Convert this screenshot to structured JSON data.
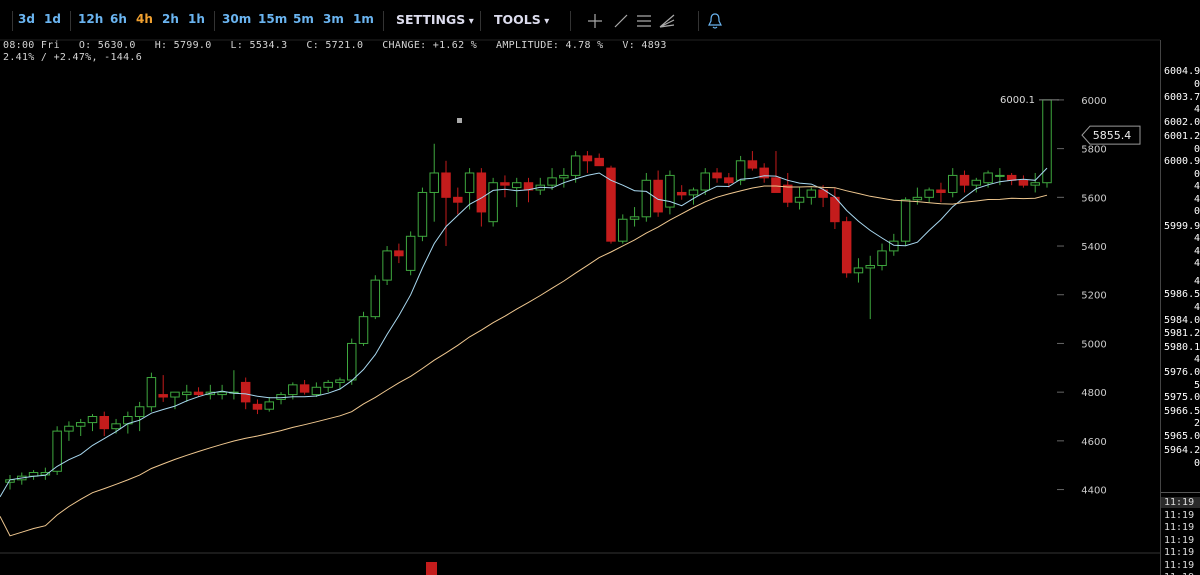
{
  "toolbar": {
    "timeframes": [
      {
        "label": "3d",
        "active": false
      },
      {
        "label": "1d",
        "active": false
      },
      {
        "label": "12h",
        "active": false
      },
      {
        "label": "6h",
        "active": false
      },
      {
        "label": "4h",
        "active": true
      },
      {
        "label": "2h",
        "active": false
      },
      {
        "label": "1h",
        "active": false
      },
      {
        "label": "30m",
        "active": false
      },
      {
        "label": "15m",
        "active": false
      },
      {
        "label": "5m",
        "active": false
      },
      {
        "label": "3m",
        "active": false
      },
      {
        "label": "1m",
        "active": false
      }
    ],
    "settings_label": "SETTINGS",
    "tools_label": "TOOLS",
    "tool_icons": [
      "crosshair-icon",
      "line-tool-icon",
      "horizontal-lines-icon",
      "fan-tool-icon",
      "alert-bell-icon"
    ]
  },
  "info": {
    "line1": "08:00 Fri   O: 5630.0   H: 5799.0   L: 5534.3   C: 5721.0   CHANGE: +1.62 %   AMPLITUDE: 4.78 %   V: 4893",
    "line2": "2.41% / +2.47%, -144.6"
  },
  "colors": {
    "up": "#3fa83f",
    "down": "#c41c1c",
    "fast_ma": "#a8d8f0",
    "slow_ma": "#f0c890",
    "grid": "#111"
  },
  "chart_data": {
    "type": "candlestick",
    "y_axis_ticks": [
      "6000",
      "5800",
      "5600",
      "5400",
      "5200",
      "5000",
      "4800",
      "4600",
      "4400"
    ],
    "ylim": [
      4275,
      6090
    ],
    "last_price_label": "5855.4",
    "high_marker_label": "6000.1",
    "candles": [
      {
        "o": 4430,
        "h": 4460,
        "l": 4400,
        "c": 4440
      },
      {
        "o": 4440,
        "h": 4470,
        "l": 4420,
        "c": 4455
      },
      {
        "o": 4455,
        "h": 4480,
        "l": 4440,
        "c": 4470
      },
      {
        "o": 4460,
        "h": 4490,
        "l": 4440,
        "c": 4470
      },
      {
        "o": 4475,
        "h": 4660,
        "l": 4460,
        "c": 4640
      },
      {
        "o": 4640,
        "h": 4680,
        "l": 4600,
        "c": 4660
      },
      {
        "o": 4660,
        "h": 4690,
        "l": 4620,
        "c": 4675
      },
      {
        "o": 4675,
        "h": 4710,
        "l": 4640,
        "c": 4700
      },
      {
        "o": 4700,
        "h": 4720,
        "l": 4620,
        "c": 4650
      },
      {
        "o": 4650,
        "h": 4690,
        "l": 4630,
        "c": 4670
      },
      {
        "o": 4670,
        "h": 4720,
        "l": 4630,
        "c": 4700
      },
      {
        "o": 4700,
        "h": 4760,
        "l": 4640,
        "c": 4740
      },
      {
        "o": 4740,
        "h": 4880,
        "l": 4720,
        "c": 4860
      },
      {
        "o": 4790,
        "h": 4870,
        "l": 4760,
        "c": 4780
      },
      {
        "o": 4780,
        "h": 4800,
        "l": 4730,
        "c": 4800
      },
      {
        "o": 4790,
        "h": 4830,
        "l": 4760,
        "c": 4800
      },
      {
        "o": 4800,
        "h": 4820,
        "l": 4780,
        "c": 4790
      },
      {
        "o": 4790,
        "h": 4830,
        "l": 4770,
        "c": 4800
      },
      {
        "o": 4790,
        "h": 4830,
        "l": 4770,
        "c": 4800
      },
      {
        "o": 4800,
        "h": 4890,
        "l": 4770,
        "c": 4800
      },
      {
        "o": 4840,
        "h": 4860,
        "l": 4730,
        "c": 4760
      },
      {
        "o": 4750,
        "h": 4770,
        "l": 4710,
        "c": 4730
      },
      {
        "o": 4730,
        "h": 4780,
        "l": 4720,
        "c": 4760
      },
      {
        "o": 4770,
        "h": 4800,
        "l": 4750,
        "c": 4790
      },
      {
        "o": 4790,
        "h": 4840,
        "l": 4770,
        "c": 4830
      },
      {
        "o": 4830,
        "h": 4850,
        "l": 4790,
        "c": 4800
      },
      {
        "o": 4790,
        "h": 4840,
        "l": 4780,
        "c": 4820
      },
      {
        "o": 4820,
        "h": 4850,
        "l": 4800,
        "c": 4840
      },
      {
        "o": 4840,
        "h": 4860,
        "l": 4810,
        "c": 4850
      },
      {
        "o": 4850,
        "h": 5020,
        "l": 4830,
        "c": 5000
      },
      {
        "o": 5000,
        "h": 5130,
        "l": 4990,
        "c": 5110
      },
      {
        "o": 5110,
        "h": 5280,
        "l": 5100,
        "c": 5260
      },
      {
        "o": 5260,
        "h": 5400,
        "l": 5240,
        "c": 5380
      },
      {
        "o": 5380,
        "h": 5410,
        "l": 5330,
        "c": 5360
      },
      {
        "o": 5300,
        "h": 5460,
        "l": 5280,
        "c": 5440
      },
      {
        "o": 5440,
        "h": 5640,
        "l": 5420,
        "c": 5620
      },
      {
        "o": 5620,
        "h": 5820,
        "l": 5500,
        "c": 5700
      },
      {
        "o": 5700,
        "h": 5750,
        "l": 5400,
        "c": 5600
      },
      {
        "o": 5600,
        "h": 5640,
        "l": 5530,
        "c": 5580
      },
      {
        "o": 5620,
        "h": 5720,
        "l": 5550,
        "c": 5700
      },
      {
        "o": 5700,
        "h": 5720,
        "l": 5480,
        "c": 5540
      },
      {
        "o": 5500,
        "h": 5680,
        "l": 5480,
        "c": 5660
      },
      {
        "o": 5660,
        "h": 5690,
        "l": 5600,
        "c": 5650
      },
      {
        "o": 5640,
        "h": 5680,
        "l": 5560,
        "c": 5660
      },
      {
        "o": 5660,
        "h": 5680,
        "l": 5580,
        "c": 5630
      },
      {
        "o": 5630,
        "h": 5680,
        "l": 5610,
        "c": 5650
      },
      {
        "o": 5650,
        "h": 5720,
        "l": 5630,
        "c": 5680
      },
      {
        "o": 5680,
        "h": 5720,
        "l": 5640,
        "c": 5690
      },
      {
        "o": 5690,
        "h": 5790,
        "l": 5660,
        "c": 5770
      },
      {
        "o": 5770,
        "h": 5790,
        "l": 5700,
        "c": 5750
      },
      {
        "o": 5760,
        "h": 5780,
        "l": 5730,
        "c": 5730
      },
      {
        "o": 5720,
        "h": 5730,
        "l": 5410,
        "c": 5420
      },
      {
        "o": 5420,
        "h": 5530,
        "l": 5410,
        "c": 5510
      },
      {
        "o": 5510,
        "h": 5560,
        "l": 5480,
        "c": 5520
      },
      {
        "o": 5520,
        "h": 5700,
        "l": 5500,
        "c": 5670
      },
      {
        "o": 5670,
        "h": 5710,
        "l": 5520,
        "c": 5540
      },
      {
        "o": 5560,
        "h": 5710,
        "l": 5530,
        "c": 5690
      },
      {
        "o": 5620,
        "h": 5650,
        "l": 5590,
        "c": 5610
      },
      {
        "o": 5610,
        "h": 5640,
        "l": 5570,
        "c": 5630
      },
      {
        "o": 5630,
        "h": 5720,
        "l": 5610,
        "c": 5700
      },
      {
        "o": 5700,
        "h": 5720,
        "l": 5660,
        "c": 5680
      },
      {
        "o": 5680,
        "h": 5700,
        "l": 5640,
        "c": 5660
      },
      {
        "o": 5670,
        "h": 5770,
        "l": 5650,
        "c": 5750
      },
      {
        "o": 5750,
        "h": 5790,
        "l": 5710,
        "c": 5720
      },
      {
        "o": 5720,
        "h": 5740,
        "l": 5660,
        "c": 5680
      },
      {
        "o": 5680,
        "h": 5790,
        "l": 5620,
        "c": 5620
      },
      {
        "o": 5650,
        "h": 5700,
        "l": 5560,
        "c": 5580
      },
      {
        "o": 5580,
        "h": 5640,
        "l": 5550,
        "c": 5600
      },
      {
        "o": 5600,
        "h": 5640,
        "l": 5570,
        "c": 5630
      },
      {
        "o": 5630,
        "h": 5650,
        "l": 5560,
        "c": 5600
      },
      {
        "o": 5600,
        "h": 5640,
        "l": 5470,
        "c": 5500
      },
      {
        "o": 5500,
        "h": 5520,
        "l": 5270,
        "c": 5290
      },
      {
        "o": 5290,
        "h": 5350,
        "l": 5250,
        "c": 5310
      },
      {
        "o": 5310,
        "h": 5360,
        "l": 5100,
        "c": 5320
      },
      {
        "o": 5320,
        "h": 5410,
        "l": 5300,
        "c": 5380
      },
      {
        "o": 5380,
        "h": 5450,
        "l": 5360,
        "c": 5420
      },
      {
        "o": 5420,
        "h": 5600,
        "l": 5400,
        "c": 5590
      },
      {
        "o": 5590,
        "h": 5640,
        "l": 5570,
        "c": 5600
      },
      {
        "o": 5600,
        "h": 5640,
        "l": 5580,
        "c": 5630
      },
      {
        "o": 5630,
        "h": 5660,
        "l": 5580,
        "c": 5620
      },
      {
        "o": 5620,
        "h": 5720,
        "l": 5600,
        "c": 5690
      },
      {
        "o": 5690,
        "h": 5710,
        "l": 5620,
        "c": 5650
      },
      {
        "o": 5650,
        "h": 5680,
        "l": 5620,
        "c": 5670
      },
      {
        "o": 5660,
        "h": 5710,
        "l": 5640,
        "c": 5700
      },
      {
        "o": 5690,
        "h": 5720,
        "l": 5650,
        "c": 5690
      },
      {
        "o": 5690,
        "h": 5700,
        "l": 5650,
        "c": 5670
      },
      {
        "o": 5670,
        "h": 5690,
        "l": 5640,
        "c": 5650
      },
      {
        "o": 5650,
        "h": 5700,
        "l": 5620,
        "c": 5660
      },
      {
        "o": 5660,
        "h": 6000,
        "l": 5640,
        "c": 6000
      }
    ],
    "price_ladder": [
      "6004.9",
      "6003.7",
      "6002.0",
      "6001.2",
      "6000.9",
      "5999.9",
      "5986.5",
      "5984.0",
      "5981.2",
      "5980.1",
      "5976.0",
      "5975.0",
      "5966.5",
      "5965.0",
      "5964.2"
    ],
    "price_ladder_fragments": [
      "0",
      "4",
      "0",
      "0",
      "4",
      "4",
      "0",
      "4",
      "4",
      "4",
      "4",
      "4",
      "4",
      "5",
      "2",
      "0"
    ],
    "trade_times": [
      "11:19",
      "11:19",
      "11:19",
      "11:19",
      "11:19",
      "11:19",
      "11:19"
    ]
  }
}
